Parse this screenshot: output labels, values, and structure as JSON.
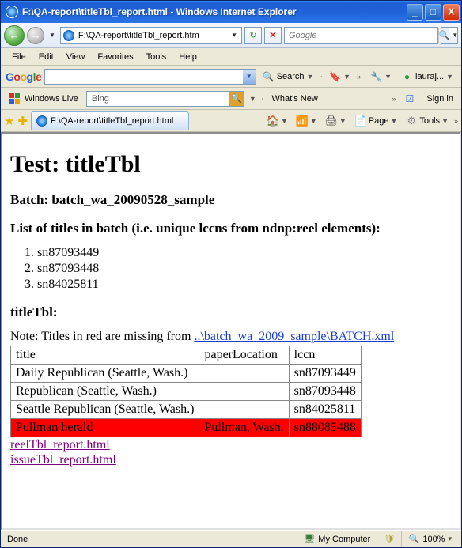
{
  "window": {
    "title": "F:\\QA-report\\titleTbl_report.html - Windows Internet Explorer"
  },
  "winbuttons": {
    "min": "_",
    "max": "□",
    "close": "X"
  },
  "nav": {
    "address": "F:\\QA-report\\titleTbl_report.htm",
    "refresh_glyph": "↻",
    "stop_glyph": "✕",
    "search_placeholder": "Google",
    "search_go_glyph": "🔍"
  },
  "menu": {
    "items": [
      "File",
      "Edit",
      "View",
      "Favorites",
      "Tools",
      "Help"
    ]
  },
  "google_toolbar": {
    "logo_letters": [
      "G",
      "o",
      "o",
      "g",
      "l",
      "e"
    ],
    "search_label": "Search",
    "user_label": "lauraj..."
  },
  "wl_toolbar": {
    "label": "Windows Live",
    "bing_placeholder": "Bing",
    "whats_new": "What's New",
    "signin": "Sign in"
  },
  "tab": {
    "label": "F:\\QA-report\\titleTbl_report.html",
    "page_label": "Page",
    "tools_label": "Tools"
  },
  "page": {
    "h1": "Test: titleTbl",
    "batch_line": "Batch: batch_wa_20090528_sample",
    "list_heading": "List of titles in batch (i.e. unique lccns from ndnp:reel elements):",
    "lccn_list": [
      "sn87093449",
      "sn87093448",
      "sn84025811"
    ],
    "tbl_heading": "titleTbl:",
    "note_prefix": "Note: Titles in red are missing from ",
    "note_link": "..\\batch_wa_2009_sample\\BATCH.xml",
    "headers": {
      "title": "title",
      "paperLocation": "paperLocation",
      "lccn": "lccn"
    },
    "rows": [
      {
        "title": "Daily Republican (Seattle, Wash.)",
        "paperLocation": "",
        "lccn": "sn87093449",
        "missing": false
      },
      {
        "title": "Republican (Seattle, Wash.)",
        "paperLocation": "",
        "lccn": "sn87093448",
        "missing": false
      },
      {
        "title": "Seattle Republican (Seattle, Wash.)",
        "paperLocation": "",
        "lccn": "sn84025811",
        "missing": false
      },
      {
        "title": "Pullman herald",
        "paperLocation": "Pullman, Wash.",
        "lccn": "sn88085488",
        "missing": true
      }
    ],
    "links": {
      "reel": "reelTbl_report.html",
      "issue": "issueTbl_report.html"
    }
  },
  "status": {
    "done": "Done",
    "zone": "My Computer",
    "zoom": "100%"
  }
}
